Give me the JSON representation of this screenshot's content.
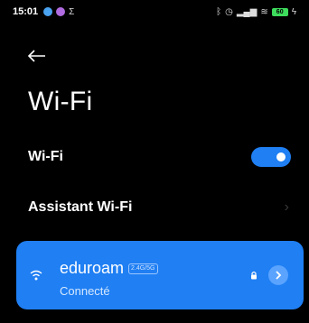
{
  "status_bar": {
    "time": "15:01",
    "notification_icons": [
      "app-icon-blue",
      "app-icon-purple",
      "notification-icon"
    ],
    "right_icons": [
      "bluetooth-icon",
      "alarm-icon",
      "signal-icon",
      "wifi-icon",
      "battery-icon"
    ],
    "battery_label": "60"
  },
  "header": {
    "title": "Wi-Fi"
  },
  "settings": {
    "wifi_label": "Wi-Fi",
    "wifi_enabled": true,
    "assistant_label": "Assistant Wi-Fi"
  },
  "network": {
    "ssid": "eduroam",
    "band": "2.4G/5G",
    "status": "Connecté",
    "secured": true
  },
  "colors": {
    "background": "#000000",
    "accent": "#1f7ff3",
    "text": "#ffffff"
  }
}
